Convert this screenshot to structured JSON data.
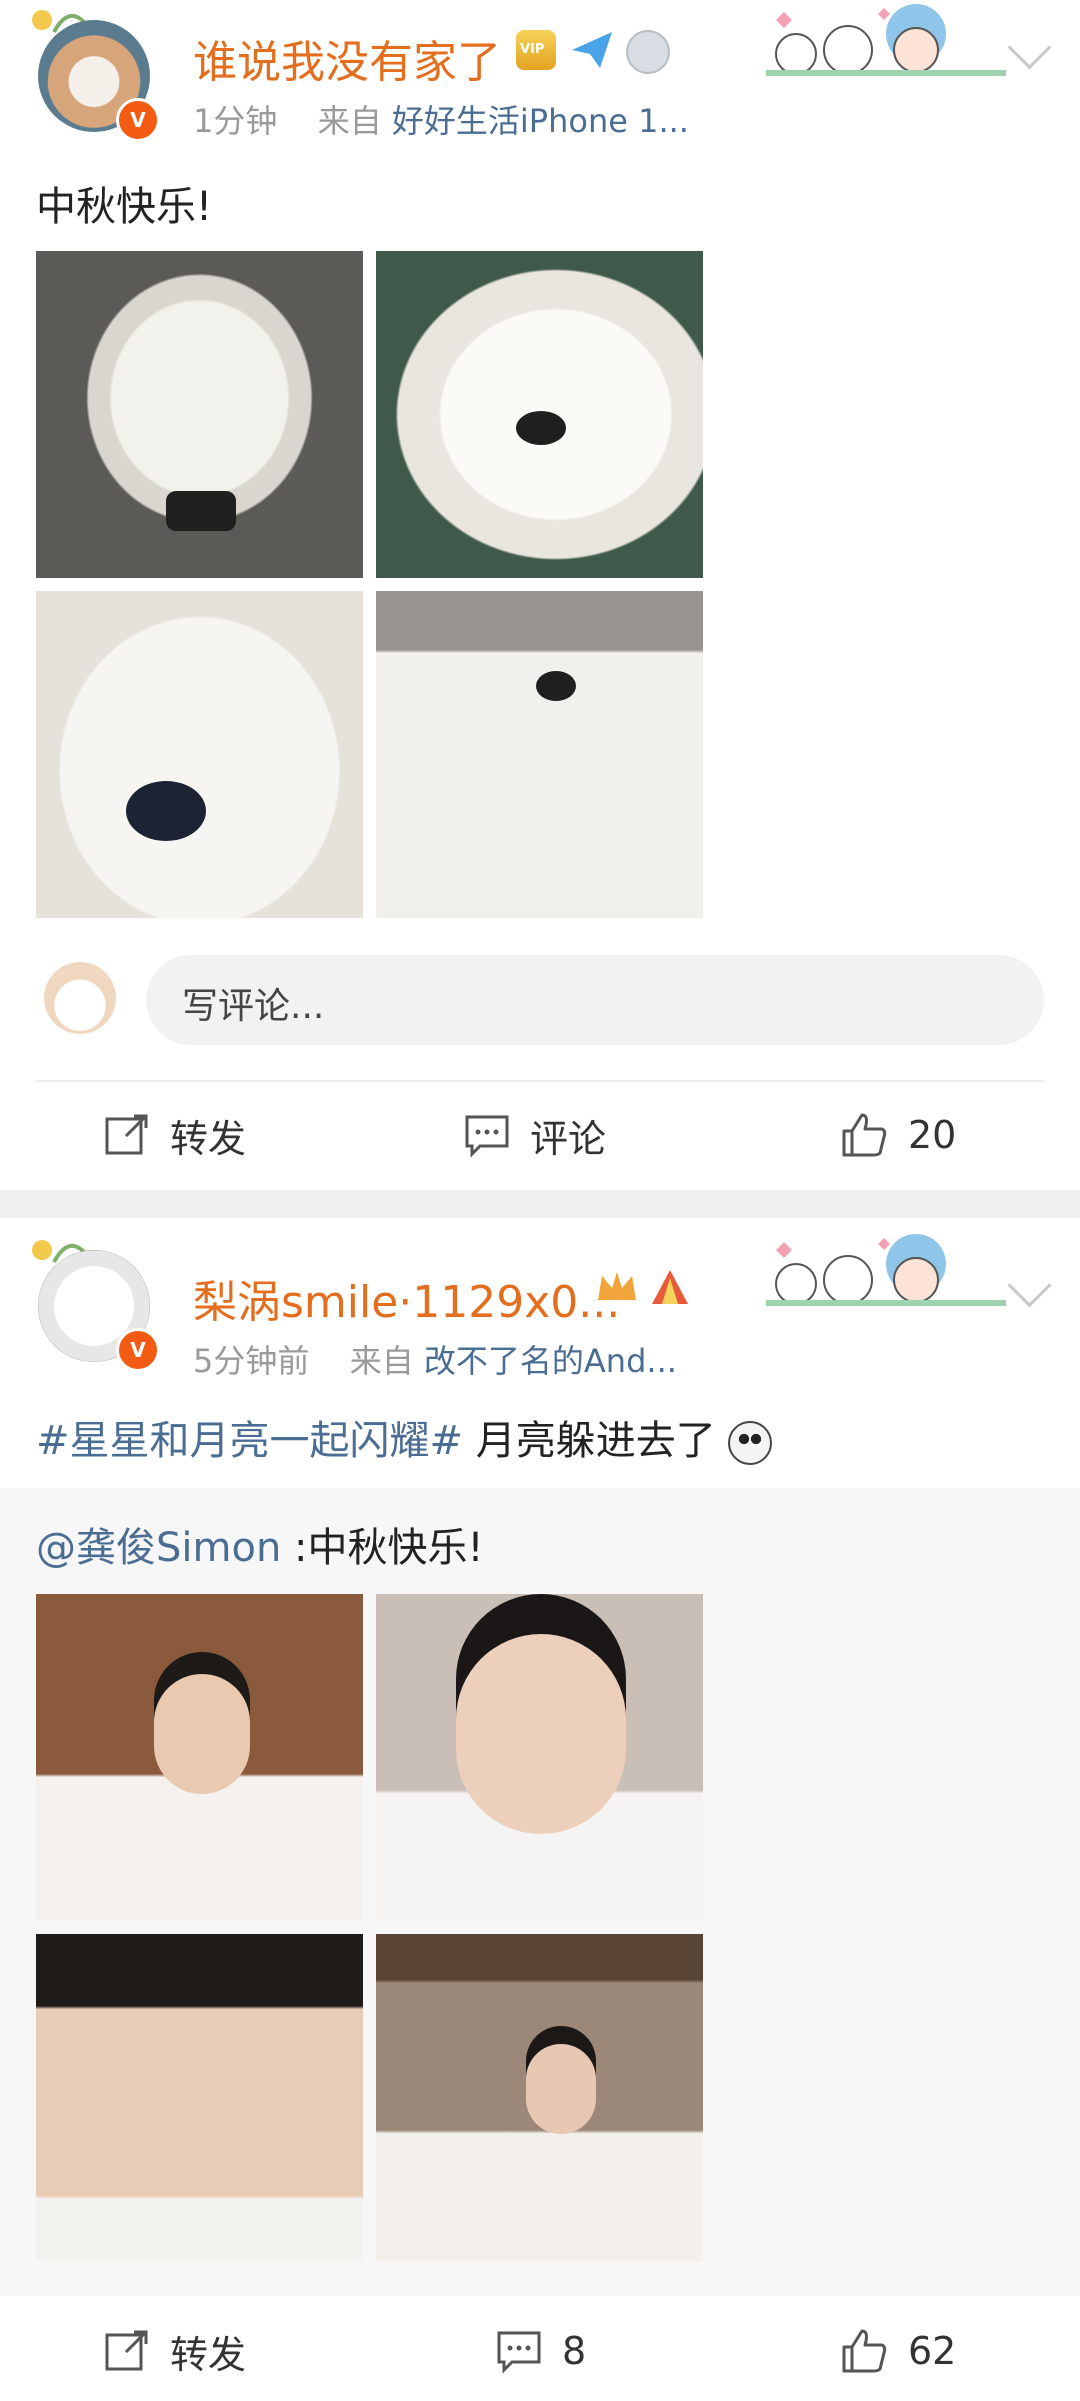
{
  "posts": [
    {
      "username": "谁说我没有家了",
      "time": "1分钟",
      "from_label": "来自",
      "source": "好好生活iPhone 1...",
      "vip_badge": "VIP",
      "text": "中秋快乐!",
      "comment_placeholder": "写评论...",
      "actions": {
        "repost": "转发",
        "comment": "评论",
        "like": "20"
      }
    },
    {
      "username": "梨涡smile·1129x0...",
      "time": "5分钟前",
      "from_label": "来自",
      "source": "改不了名的And...",
      "hashtag": "#星星和月亮一起闪耀#",
      "text": " 月亮躲进去了",
      "repost": {
        "at_user": "@龚俊Simon",
        "text": " :中秋快乐!"
      },
      "actions": {
        "repost": "转发",
        "comment": "8",
        "like": "62"
      }
    }
  ],
  "colors": {
    "username": "#e36e1e",
    "link": "#4a6d94",
    "meta": "#9a9a9a",
    "vbadge": "#f35a12"
  }
}
